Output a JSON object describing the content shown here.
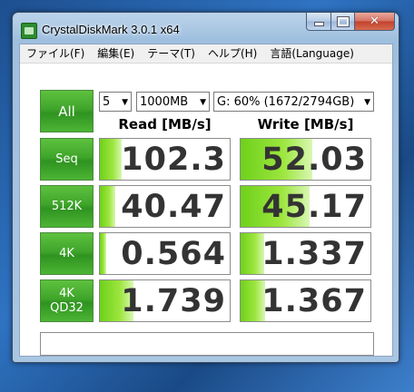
{
  "window": {
    "title": "CrystalDiskMark 3.0.1 x64",
    "close_glyph": "✕"
  },
  "menu": [
    {
      "label": "ファイル(F)"
    },
    {
      "label": "編集(E)"
    },
    {
      "label": "テーマ(T)"
    },
    {
      "label": "ヘルプ(H)"
    },
    {
      "label": "言語(Language)"
    }
  ],
  "controls": {
    "all_label": "All",
    "count": "5",
    "size": "1000MB",
    "drive": "G: 60% (1672/2794GB)",
    "arrow_glyph": "▼"
  },
  "columns": {
    "read": "Read [MB/s]",
    "write": "Write [MB/s]"
  },
  "tests": [
    {
      "label_line1": "Seq",
      "label_line2": "",
      "read": "102.3",
      "write": "52.03",
      "read_fill": 0.17,
      "write_fill": 0.55
    },
    {
      "label_line1": "512K",
      "label_line2": "",
      "read": "40.47",
      "write": "45.17",
      "read_fill": 0.12,
      "write_fill": 0.53
    },
    {
      "label_line1": "4K",
      "label_line2": "",
      "read": "0.564",
      "write": "1.337",
      "read_fill": 0.05,
      "write_fill": 0.18
    },
    {
      "label_line1": "4K",
      "label_line2": "QD32",
      "read": "1.739",
      "write": "1.367",
      "read_fill": 0.26,
      "write_fill": 0.19
    }
  ],
  "colors": {
    "button_green": "#3fa52a",
    "bar_green": "#6ed11a"
  }
}
